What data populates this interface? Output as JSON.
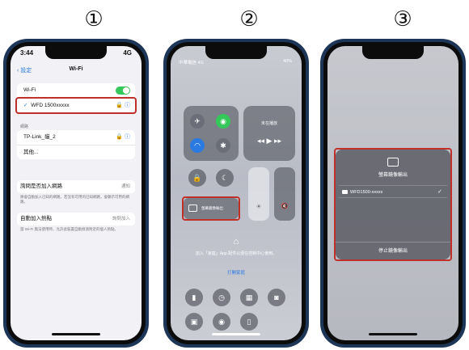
{
  "steps": [
    "①",
    "②",
    "③"
  ],
  "phone1": {
    "status_time": "3:44",
    "status_signal": "4G",
    "back_label": "設定",
    "title": "Wi-Fi",
    "wifi_label": "Wi-Fi",
    "connected_network": "WFD 1500xxxxx",
    "section_networks": "網路",
    "other_networks": [
      "TP-Link_貓_2",
      "其他..."
    ],
    "ask_join_label": "詢問是否加入網路",
    "ask_join_value": "通知",
    "ask_join_note": "將會自動加入已知的網路。若沒有可用的已知網路，會顯示可用的網路。",
    "auto_join_label": "自動加入熱點",
    "auto_join_value": "詢問加入",
    "auto_join_note": "當 Wi-Fi 無法使用時，允許此裝置自動偵測附近的個人熱點。"
  },
  "phone2": {
    "carrier": "中華電信 4G",
    "battery": "40%",
    "music_title": "未在播放",
    "mirror_label": "螢幕鏡像輸出",
    "hint": "加入「家庭」App 配件以便在控制中心使用。",
    "hint_link": "打開家庭"
  },
  "phone3": {
    "popup_title": "螢幕鏡像輸出",
    "device_name": "WFD1500-xxxxx",
    "stop_label": "停止鏡像輸出"
  },
  "colors": {
    "highlight": "#c0302a",
    "ios_blue": "#2a7ae2",
    "ios_green": "#34c759"
  }
}
